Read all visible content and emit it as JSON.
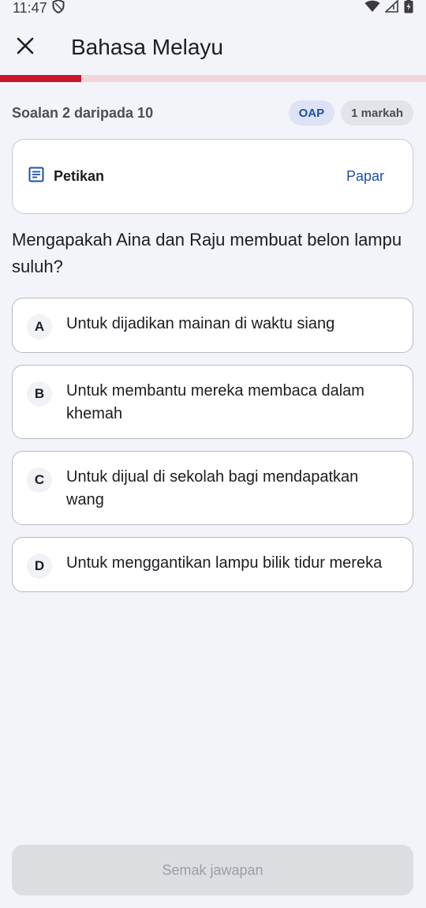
{
  "status_bar": {
    "time": "11:47"
  },
  "app_bar": {
    "title": "Bahasa Melayu"
  },
  "progress": {
    "current": 2,
    "total": 10,
    "fraction": 0.19
  },
  "meta": {
    "question_count": "Soalan 2 daripada 10",
    "badge_category": "OAP",
    "badge_marks": "1 markah"
  },
  "passage": {
    "label": "Petikan",
    "open_label": "Papar"
  },
  "question": {
    "text": "Mengapakah Aina dan Raju membuat belon lampu suluh?"
  },
  "options": [
    {
      "letter": "A",
      "text": "Untuk dijadikan mainan di waktu siang"
    },
    {
      "letter": "B",
      "text": "Untuk membantu mereka membaca dalam khemah"
    },
    {
      "letter": "C",
      "text": "Untuk dijual di sekolah bagi mendapatkan wang"
    },
    {
      "letter": "D",
      "text": "Untuk menggantikan lampu bilik tidur mereka"
    }
  ],
  "footer": {
    "check_label": "Semak jawapan"
  },
  "colors": {
    "accent": "#c8172a",
    "progress_track": "#f2d6dc",
    "link": "#1f4fa8",
    "background": "#f3f4f9"
  }
}
